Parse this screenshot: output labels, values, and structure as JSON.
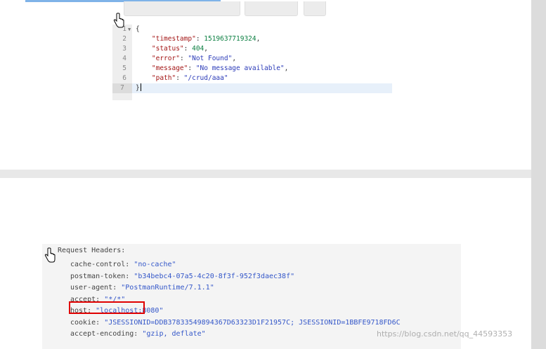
{
  "response": {
    "lines": [
      {
        "num": "1",
        "open": "{"
      },
      {
        "num": "2",
        "key": "\"timestamp\"",
        "value": "1519637719324",
        "value_type": "number",
        "comma": ","
      },
      {
        "num": "3",
        "key": "\"status\"",
        "value": "404",
        "value_type": "number",
        "comma": ","
      },
      {
        "num": "4",
        "key": "\"error\"",
        "value": "\"Not Found\"",
        "value_type": "string",
        "comma": ","
      },
      {
        "num": "5",
        "key": "\"message\"",
        "value": "\"No message available\"",
        "value_type": "string",
        "comma": ","
      },
      {
        "num": "6",
        "key": "\"path\"",
        "value": "\"/crud/aaa\"",
        "value_type": "string",
        "comma": ""
      },
      {
        "num": "7",
        "close": "}"
      }
    ]
  },
  "request_headers": {
    "title": "Request Headers:",
    "items": [
      {
        "key": "cache-control:",
        "value": "\"no-cache\""
      },
      {
        "key": "postman-token:",
        "value": "\"b34bebc4-07a5-4c20-8f3f-952f3daec38f\""
      },
      {
        "key": "user-agent:",
        "value": "\"PostmanRuntime/7.1.1\""
      },
      {
        "key": "accept:",
        "value": "\"*/*\"",
        "highlighted": true
      },
      {
        "key": "host:",
        "value": "\"localhost:8080\""
      },
      {
        "key": "cookie:",
        "value": "\"JSESSIONID=DDB37833549894367D63323D1F21957C; JSESSIONID=1BBFE9718FD6C"
      },
      {
        "key": "accept-encoding:",
        "value": "\"gzip, deflate\""
      }
    ]
  },
  "watermark": "https://blog.csdn.net/qq_44593353",
  "colors": {
    "highlight": "#e00000",
    "string": "#2a3ab8",
    "key": "#a31515",
    "number": "#0b7f41"
  },
  "icons": [
    "hand-pointer-icon",
    "fold-arrow-icon"
  ]
}
